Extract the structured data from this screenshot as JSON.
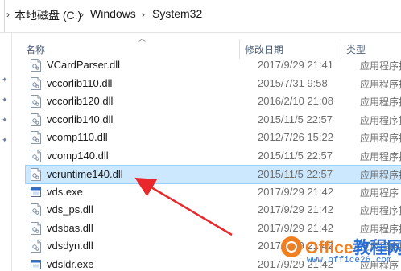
{
  "breadcrumb": {
    "items": [
      "本地磁盘 (C:)",
      "Windows",
      "System32"
    ]
  },
  "columns": {
    "name": "名称",
    "date": "修改日期",
    "type": "类型"
  },
  "files": [
    {
      "name": "VCardParser.dll",
      "date": "2017/9/29 21:41",
      "type": "应用程序扩展",
      "icon": "dll-icon"
    },
    {
      "name": "vccorlib110.dll",
      "date": "2015/7/31 9:58",
      "type": "应用程序扩展",
      "icon": "dll-icon"
    },
    {
      "name": "vccorlib120.dll",
      "date": "2016/2/10 21:08",
      "type": "应用程序扩展",
      "icon": "dll-icon"
    },
    {
      "name": "vccorlib140.dll",
      "date": "2015/11/5 22:57",
      "type": "应用程序扩展",
      "icon": "dll-icon"
    },
    {
      "name": "vcomp110.dll",
      "date": "2012/7/26 15:22",
      "type": "应用程序扩展",
      "icon": "dll-icon"
    },
    {
      "name": "vcomp140.dll",
      "date": "2015/11/5 22:57",
      "type": "应用程序扩展",
      "icon": "dll-icon"
    },
    {
      "name": "vcruntime140.dll",
      "date": "2015/11/5 22:57",
      "type": "应用程序扩展",
      "icon": "dll-icon",
      "selected": true
    },
    {
      "name": "vds.exe",
      "date": "2017/9/29 21:42",
      "type": "应用程序",
      "icon": "exe-icon"
    },
    {
      "name": "vds_ps.dll",
      "date": "2017/9/29 21:42",
      "type": "应用程序扩展",
      "icon": "dll-icon"
    },
    {
      "name": "vdsbas.dll",
      "date": "2017/9/29 21:42",
      "type": "应用程序扩展",
      "icon": "dll-icon"
    },
    {
      "name": "vdsdyn.dll",
      "date": "2017/9/29 21:42",
      "type": "应用程序扩展",
      "icon": "dll-icon"
    },
    {
      "name": "vdsldr.exe",
      "date": "2017/9/29 21:42",
      "type": "应用程序",
      "icon": "exe-icon"
    }
  ],
  "watermark": {
    "brand_a": "Office",
    "brand_b": "教程网",
    "url": "www.office26.com"
  },
  "colors": {
    "selection_bg": "#cce8ff",
    "selection_border": "#99d1ff",
    "arrow": "#e8282b",
    "header_text": "#4c607a"
  }
}
